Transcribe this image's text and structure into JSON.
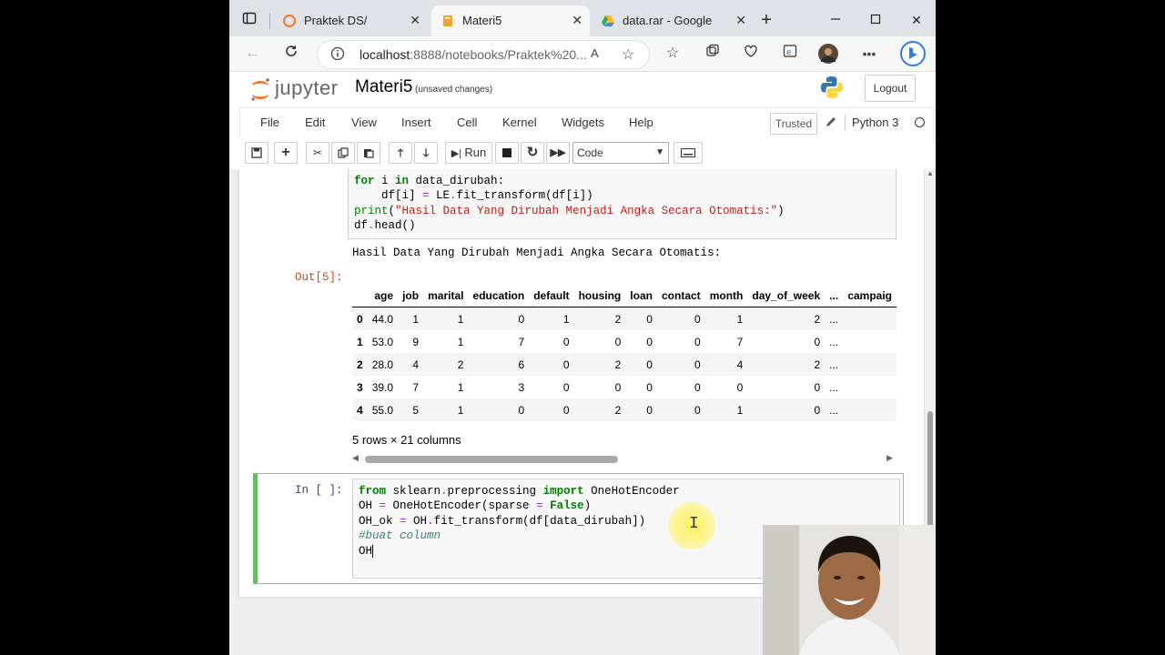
{
  "browser": {
    "tabs": [
      {
        "title": "Praktek DS/",
        "active": false
      },
      {
        "title": "Materi5",
        "active": true
      },
      {
        "title": "data.rar - Google Drive",
        "active": false
      }
    ],
    "url_host": "localhost",
    "url_rest": ":8888/notebooks/Praktek%20..."
  },
  "jupyter": {
    "logo_text": "jupyter",
    "notebook_name": "Materi5",
    "save_status": "(unsaved changes)",
    "logout_label": "Logout",
    "menu": [
      "File",
      "Edit",
      "View",
      "Insert",
      "Cell",
      "Kernel",
      "Widgets",
      "Help"
    ],
    "trusted_label": "Trusted",
    "kernel_name": "Python 3",
    "toolbar": {
      "run_label": "Run",
      "cell_type": "Code"
    }
  },
  "cell1": {
    "code_lines": [
      "for i in data_dirubah:",
      "    df[i] = LE.fit_transform(df[i])",
      "print(\"Hasil Data Yang Dirubah Menjadi Angka Secara Otomatis:\")",
      "df.head()"
    ],
    "stdout": "Hasil Data Yang Dirubah Menjadi Angka Secara Otomatis:",
    "out_prompt": "Out[5]:"
  },
  "dataframe": {
    "columns": [
      "",
      "age",
      "job",
      "marital",
      "education",
      "default",
      "housing",
      "loan",
      "contact",
      "month",
      "day_of_week",
      "...",
      "campaig"
    ],
    "rows": [
      [
        "0",
        "44.0",
        "1",
        "1",
        "0",
        "1",
        "2",
        "0",
        "0",
        "1",
        "2",
        "...",
        ""
      ],
      [
        "1",
        "53.0",
        "9",
        "1",
        "7",
        "0",
        "0",
        "0",
        "0",
        "7",
        "0",
        "...",
        ""
      ],
      [
        "2",
        "28.0",
        "4",
        "2",
        "6",
        "0",
        "2",
        "0",
        "0",
        "4",
        "2",
        "...",
        ""
      ],
      [
        "3",
        "39.0",
        "7",
        "1",
        "3",
        "0",
        "0",
        "0",
        "0",
        "0",
        "0",
        "...",
        ""
      ],
      [
        "4",
        "55.0",
        "5",
        "1",
        "0",
        "0",
        "2",
        "0",
        "0",
        "1",
        "0",
        "...",
        ""
      ]
    ],
    "shape_text": "5 rows × 21 columns"
  },
  "cell2": {
    "in_prompt": "In [ ]:",
    "code_lines": [
      "from sklearn.preprocessing import OneHotEncoder",
      "OH = OneHotEncoder(sparse = False)",
      "OH_ok = OH.fit_transform(df[data_dirubah])",
      "#buat column",
      "OH"
    ]
  }
}
